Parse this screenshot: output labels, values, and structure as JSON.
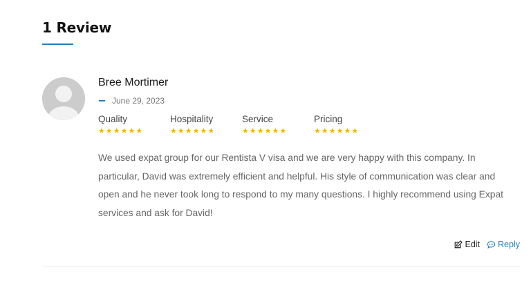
{
  "section": {
    "title": "1 Review"
  },
  "review": {
    "author": "Bree Mortimer",
    "date": "June 29, 2023",
    "ratings": [
      {
        "label": "Quality",
        "stars": 6
      },
      {
        "label": "Hospitality",
        "stars": 6
      },
      {
        "label": "Service",
        "stars": 6
      },
      {
        "label": "Pricing",
        "stars": 6
      }
    ],
    "text": "We used expat group for our Rentista V visa and we are very happy with this company. In particular, David was extremely efficient and helpful. His style of communication was clear and open and he never took long to respond to my many questions. I highly recommend using Expat services and ask for David!"
  },
  "actions": {
    "edit_label": "Edit",
    "reply_label": "Reply"
  },
  "colors": {
    "accent": "#1e7fc2",
    "star": "#f5b301"
  },
  "icons": {
    "edit": "edit-icon",
    "reply": "reply-icon",
    "star": "star-icon",
    "avatar": "avatar-placeholder-icon"
  }
}
